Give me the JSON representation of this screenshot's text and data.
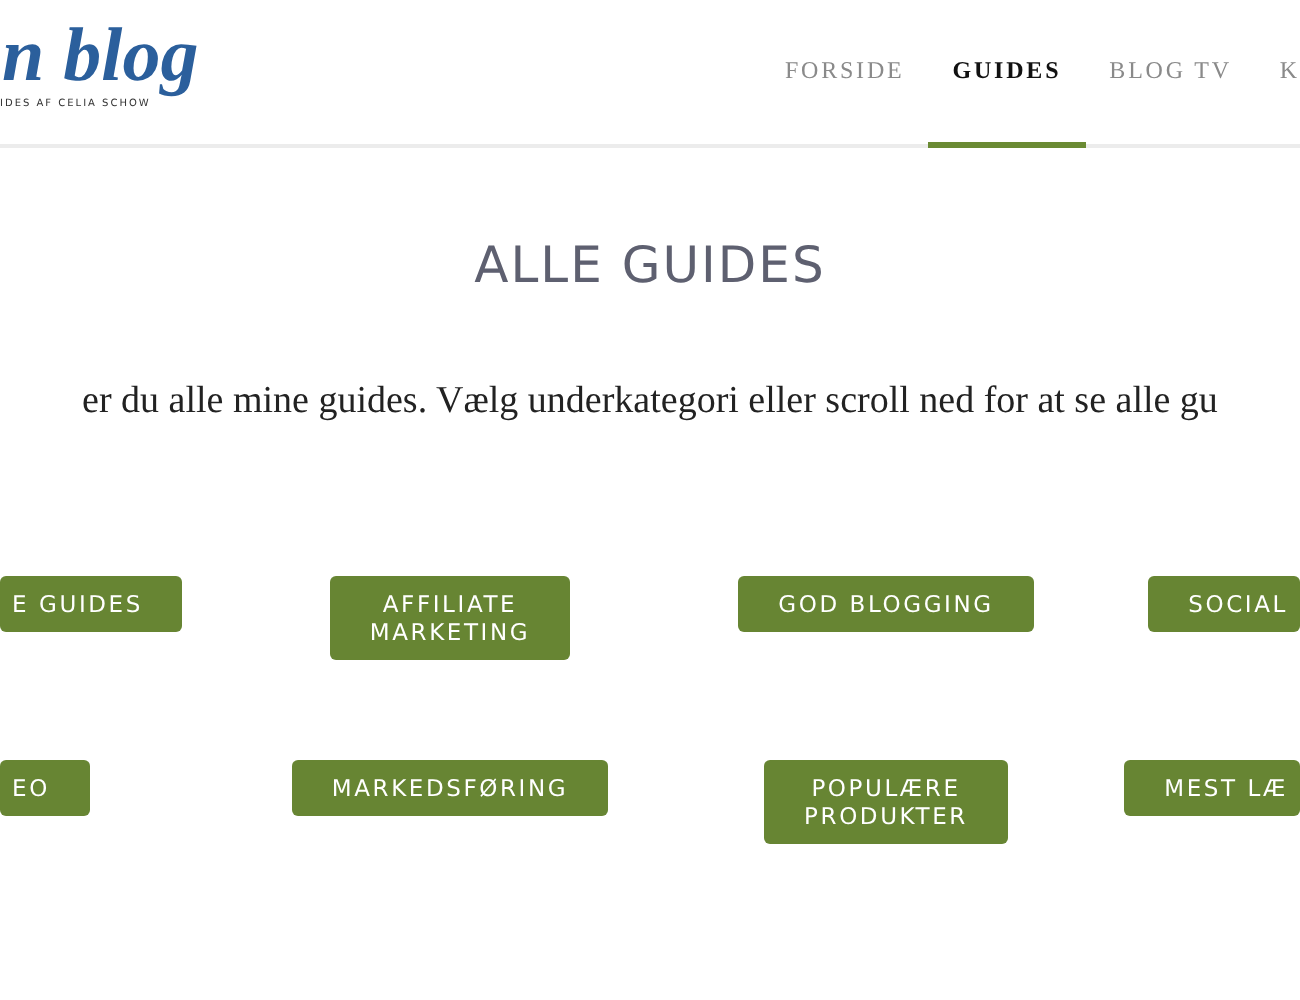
{
  "logo": {
    "title": "n blog",
    "tagline": "IDES AF CELIA SCHOW"
  },
  "nav": [
    {
      "label": "FORSIDE",
      "selected": false
    },
    {
      "label": "GUIDES",
      "selected": true
    },
    {
      "label": "BLOG TV",
      "selected": false
    },
    {
      "label": "K",
      "selected": false
    }
  ],
  "heading": "ALLE GUIDES",
  "intro": "er du alle mine guides. Vælg underkategori eller scroll ned for at se alle gu",
  "category_rows": [
    [
      {
        "lines": [
          "E GUIDES"
        ]
      },
      {
        "lines": [
          "AFFILIATE",
          "MARKETING"
        ]
      },
      {
        "lines": [
          "GOD BLOGGING"
        ]
      },
      {
        "lines": [
          "SOCIAL"
        ]
      }
    ],
    [
      {
        "lines": [
          "EO"
        ]
      },
      {
        "lines": [
          "MARKEDSFØRING"
        ]
      },
      {
        "lines": [
          "POPULÆRE",
          "PRODUKTER"
        ]
      },
      {
        "lines": [
          "MEST LÆ"
        ]
      }
    ]
  ]
}
